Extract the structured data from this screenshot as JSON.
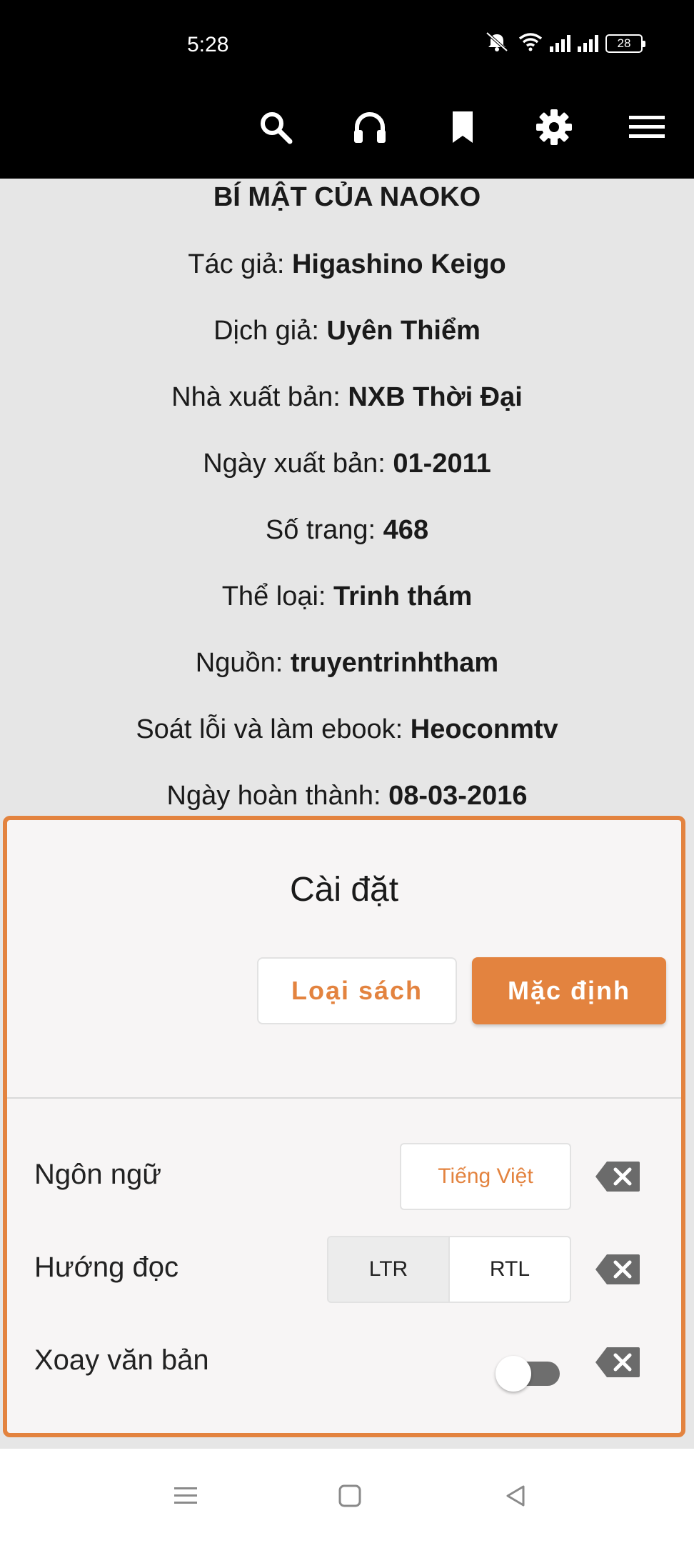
{
  "status_bar": {
    "time": "5:28",
    "battery": "28",
    "icons": [
      "mute-icon",
      "wifi-icon",
      "signal-icon",
      "signal-icon",
      "battery-icon"
    ]
  },
  "toolbar": {
    "icons": [
      "search-icon",
      "headphones-icon",
      "bookmark-icon",
      "gear-icon",
      "menu-icon"
    ]
  },
  "book": {
    "title": "BÍ MẬT CỦA NAOKO",
    "fields": [
      {
        "label": "Tác giả: ",
        "value": "Higashino Keigo"
      },
      {
        "label": "Dịch giả: ",
        "value": "Uyên Thiểm"
      },
      {
        "label": "Nhà xuất bản: ",
        "value": "NXB Thời Đại"
      },
      {
        "label": "Ngày xuất bản: ",
        "value": "01-2011"
      },
      {
        "label": "Số trang: ",
        "value": "468"
      },
      {
        "label": "Thể loại: ",
        "value": "Trinh thám"
      },
      {
        "label": "Nguồn: ",
        "value": "truyentrinhtham"
      },
      {
        "label": "Soát lỗi và làm ebook: ",
        "value": "Heoconmtv"
      },
      {
        "label": "Ngày hoàn thành: ",
        "value": "08-03-2016"
      }
    ]
  },
  "settings": {
    "title": "Cài đặt",
    "book_type_button": "Loại sách",
    "default_button": "Mặc định",
    "language": {
      "label": "Ngôn ngữ",
      "value": "Tiếng Việt"
    },
    "reading_direction": {
      "label": "Hướng đọc",
      "options": [
        "LTR",
        "RTL"
      ],
      "selected": "LTR"
    },
    "rotate_text": {
      "label": "Xoay văn bản",
      "enabled": false
    }
  },
  "colors": {
    "accent": "#e3833f",
    "panel_bg": "#f7f5f5",
    "page_bg": "#e6e6e6",
    "topbar_bg": "#000000"
  },
  "nav": {
    "icons": [
      "recent-apps-icon",
      "home-icon",
      "back-icon"
    ]
  }
}
